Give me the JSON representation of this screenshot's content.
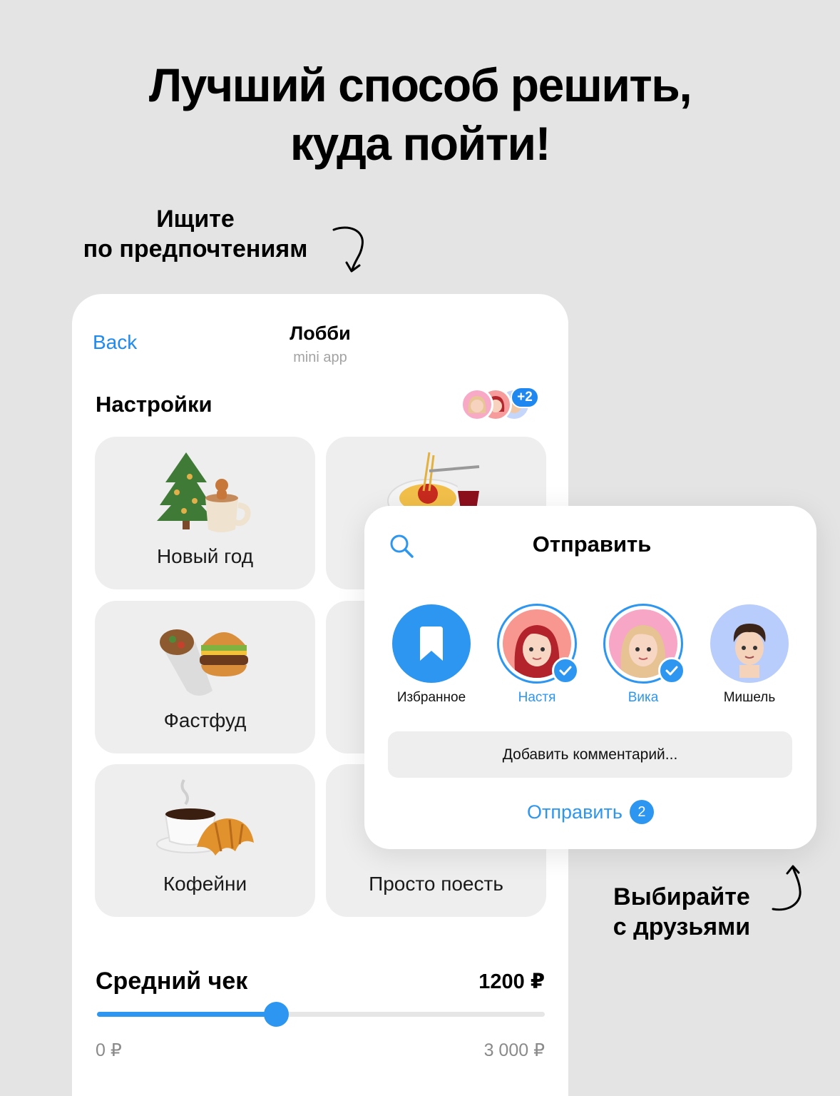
{
  "headline": {
    "line1": "Лучший способ решить,",
    "line2": "куда пойти!"
  },
  "captions": {
    "left_line1": "Ищите",
    "left_line2": "по предпочтениям",
    "right_line1": "Выбирайте",
    "right_line2": "с друзьями"
  },
  "lobby": {
    "back_label": "Back",
    "title": "Лобби",
    "subtitle": "mini app",
    "section_title": "Настройки",
    "extra_members": "+2",
    "tiles": [
      {
        "label": "Новый год",
        "icon": "christmas-tree-cocoa-icon"
      },
      {
        "label": "",
        "icon": "spaghetti-wine-icon"
      },
      {
        "label": "Фастфуд",
        "icon": "burrito-burger-icon"
      },
      {
        "label": "",
        "icon": "hidden-tile-icon"
      },
      {
        "label": "Кофейни",
        "icon": "coffee-croissant-icon"
      },
      {
        "label": "Просто поесть",
        "icon": "plate-icon"
      }
    ],
    "price": {
      "title": "Средний чек",
      "value": "1200 ₽",
      "min_label": "0 ₽",
      "max_label": "3 000 ₽",
      "min": 0,
      "max": 3000,
      "current": 1200
    }
  },
  "share_sheet": {
    "title": "Отправить",
    "contacts": [
      {
        "name": "Избранное",
        "selected": false,
        "icon": "bookmark-icon"
      },
      {
        "name": "Настя",
        "selected": true,
        "icon": "avatar-red-hair"
      },
      {
        "name": "Вика",
        "selected": true,
        "icon": "avatar-blonde"
      },
      {
        "name": "Мишель",
        "selected": false,
        "icon": "avatar-boy"
      }
    ],
    "comment_placeholder": "Добавить комментарий...",
    "send_label": "Отправить",
    "send_count": "2"
  },
  "colors": {
    "accent": "#2d96f0",
    "background": "#e4e4e4",
    "tile": "#eeeeee"
  }
}
